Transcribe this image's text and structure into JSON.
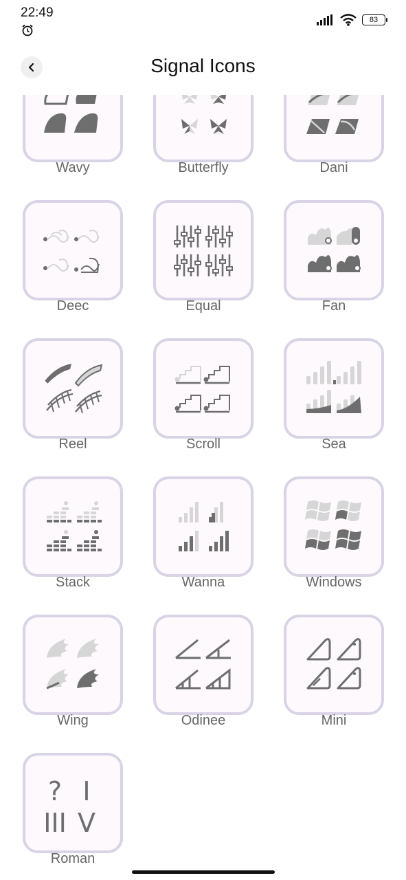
{
  "status_bar": {
    "time": "22:49",
    "battery": "83"
  },
  "header": {
    "title": "Signal Icons"
  },
  "icons": [
    {
      "label": "Wavy",
      "icon": "wavy-icon"
    },
    {
      "label": "Butterfly",
      "icon": "butterfly-icon"
    },
    {
      "label": "Dani",
      "icon": "dani-icon"
    },
    {
      "label": "Deec",
      "icon": "deec-icon"
    },
    {
      "label": "Equal",
      "icon": "equal-icon"
    },
    {
      "label": "Fan",
      "icon": "fan-icon"
    },
    {
      "label": "Reel",
      "icon": "reel-icon"
    },
    {
      "label": "Scroll",
      "icon": "scroll-icon"
    },
    {
      "label": "Sea",
      "icon": "sea-icon"
    },
    {
      "label": "Stack",
      "icon": "stack-icon"
    },
    {
      "label": "Wanna",
      "icon": "wanna-icon"
    },
    {
      "label": "Windows",
      "icon": "windows-icon"
    },
    {
      "label": "Wing",
      "icon": "wing-icon"
    },
    {
      "label": "Odinee",
      "icon": "odinee-icon"
    },
    {
      "label": "Mini",
      "icon": "mini-icon"
    },
    {
      "label": "Roman",
      "icon": "roman-icon",
      "glyphs": [
        "?",
        "I",
        "III",
        "V"
      ]
    }
  ],
  "colors": {
    "tile_border": "#d9d3e6",
    "tile_bg": "#fdf9fd",
    "icon_dark": "#6e6e6e",
    "icon_light": "#d6d6d6"
  }
}
